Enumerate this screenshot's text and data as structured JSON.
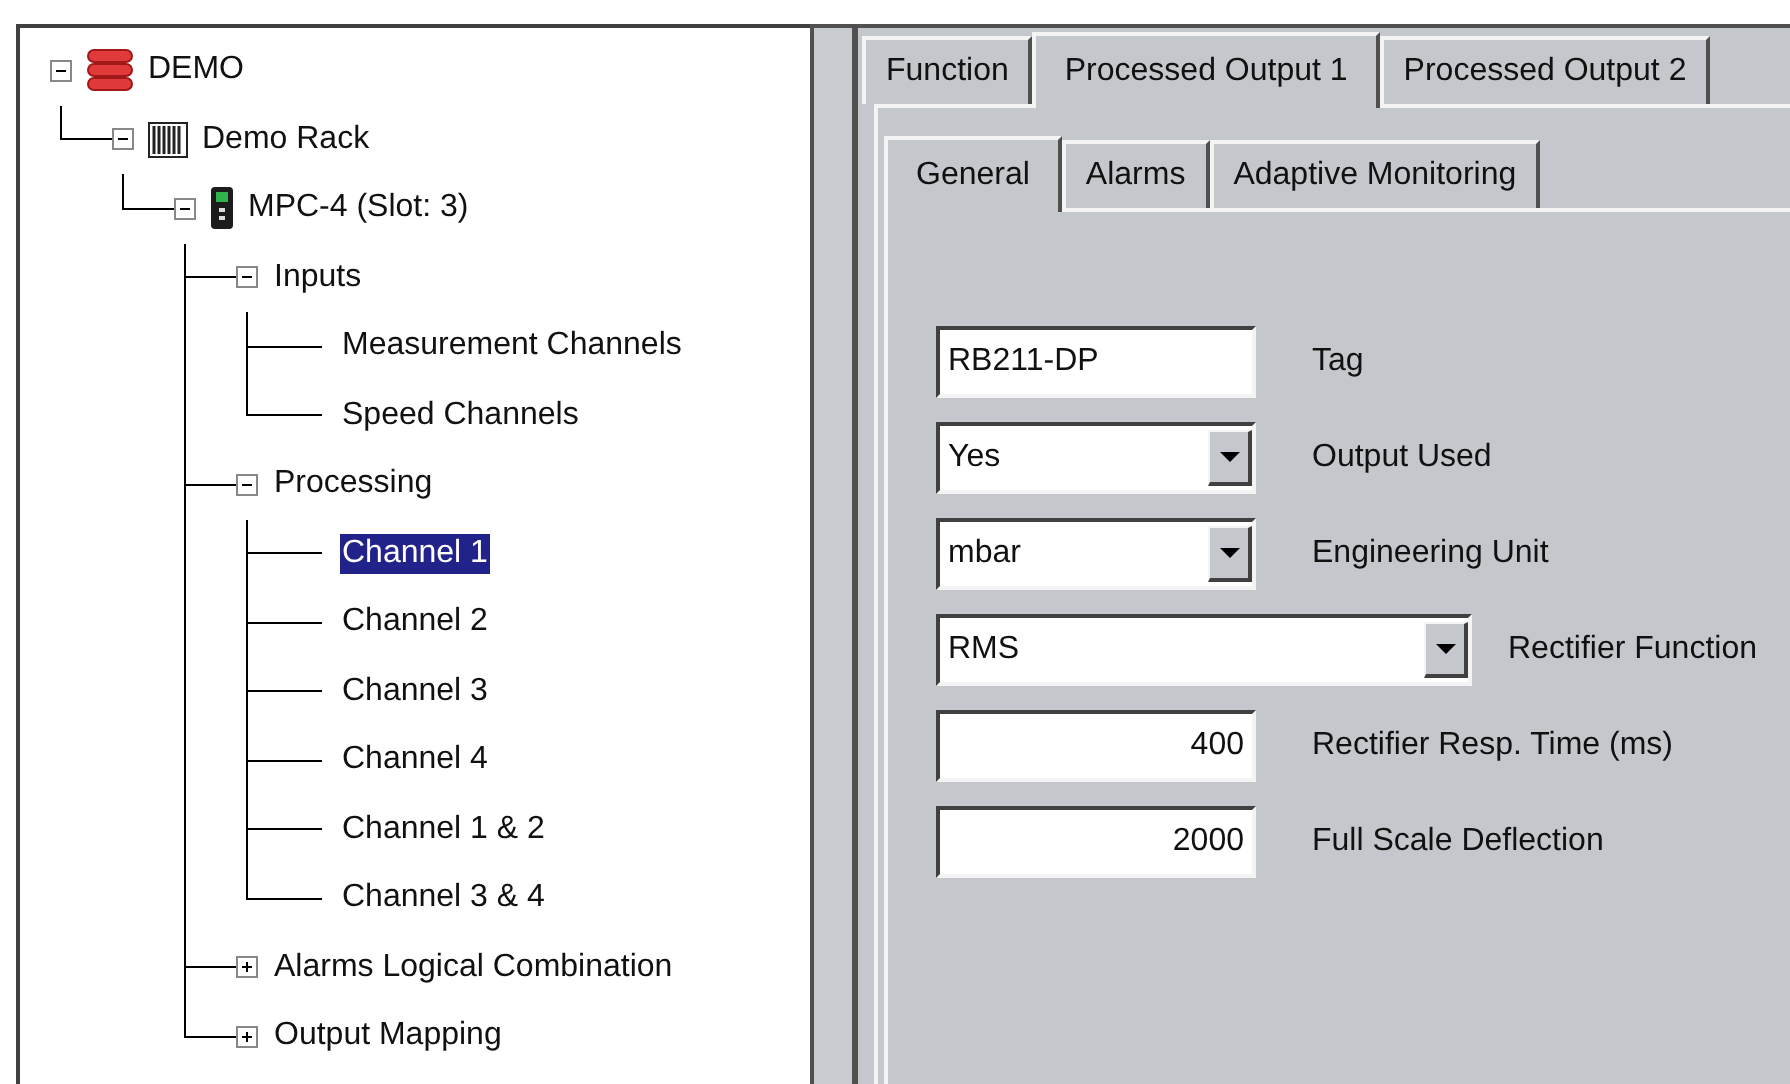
{
  "tree": [
    {
      "label": "DEMO",
      "kind": "database",
      "expanded": true,
      "selected": false,
      "children": [
        {
          "label": "Demo Rack",
          "kind": "rack",
          "expanded": true,
          "selected": false,
          "children": [
            {
              "label": "MPC-4 (Slot:  3)",
              "kind": "module",
              "expanded": true,
              "selected": false,
              "children": [
                {
                  "label": "Inputs",
                  "expanded": true,
                  "selected": false,
                  "children": [
                    {
                      "label": "Measurement Channels",
                      "selected": false
                    },
                    {
                      "label": "Speed Channels",
                      "selected": false
                    }
                  ]
                },
                {
                  "label": "Processing",
                  "expanded": true,
                  "selected": false,
                  "children": [
                    {
                      "label": "Channel 1",
                      "selected": true
                    },
                    {
                      "label": "Channel 2",
                      "selected": false
                    },
                    {
                      "label": "Channel 3",
                      "selected": false
                    },
                    {
                      "label": "Channel 4",
                      "selected": false
                    },
                    {
                      "label": "Channel 1 & 2",
                      "selected": false
                    },
                    {
                      "label": "Channel 3 & 4",
                      "selected": false
                    }
                  ]
                },
                {
                  "label": "Alarms Logical Combination",
                  "expanded": false,
                  "selected": false
                },
                {
                  "label": "Output Mapping",
                  "expanded": false,
                  "selected": false
                }
              ]
            }
          ]
        }
      ]
    }
  ],
  "tabs": [
    {
      "label": "Function",
      "selected": false
    },
    {
      "label": "Processed Output 1",
      "selected": true
    },
    {
      "label": "Processed Output 2",
      "selected": false
    }
  ],
  "subtabs": [
    {
      "label": "General",
      "selected": true
    },
    {
      "label": "Alarms",
      "selected": false
    },
    {
      "label": "Adaptive Monitoring",
      "selected": false
    }
  ],
  "fields": [
    {
      "kind": "text",
      "value": "RB211-DP",
      "label": "Tag"
    },
    {
      "kind": "select",
      "value": "Yes",
      "label": "Output Used",
      "wide": false
    },
    {
      "kind": "select",
      "value": "mbar",
      "label": "Engineering Unit",
      "wide": false
    },
    {
      "kind": "select",
      "value": "RMS",
      "label": "Rectifier Function",
      "wide": true
    },
    {
      "kind": "number",
      "value": "400",
      "label": "Rectifier Resp. Time (ms)"
    },
    {
      "kind": "number",
      "value": "2000",
      "label": "Full Scale Deflection"
    }
  ]
}
